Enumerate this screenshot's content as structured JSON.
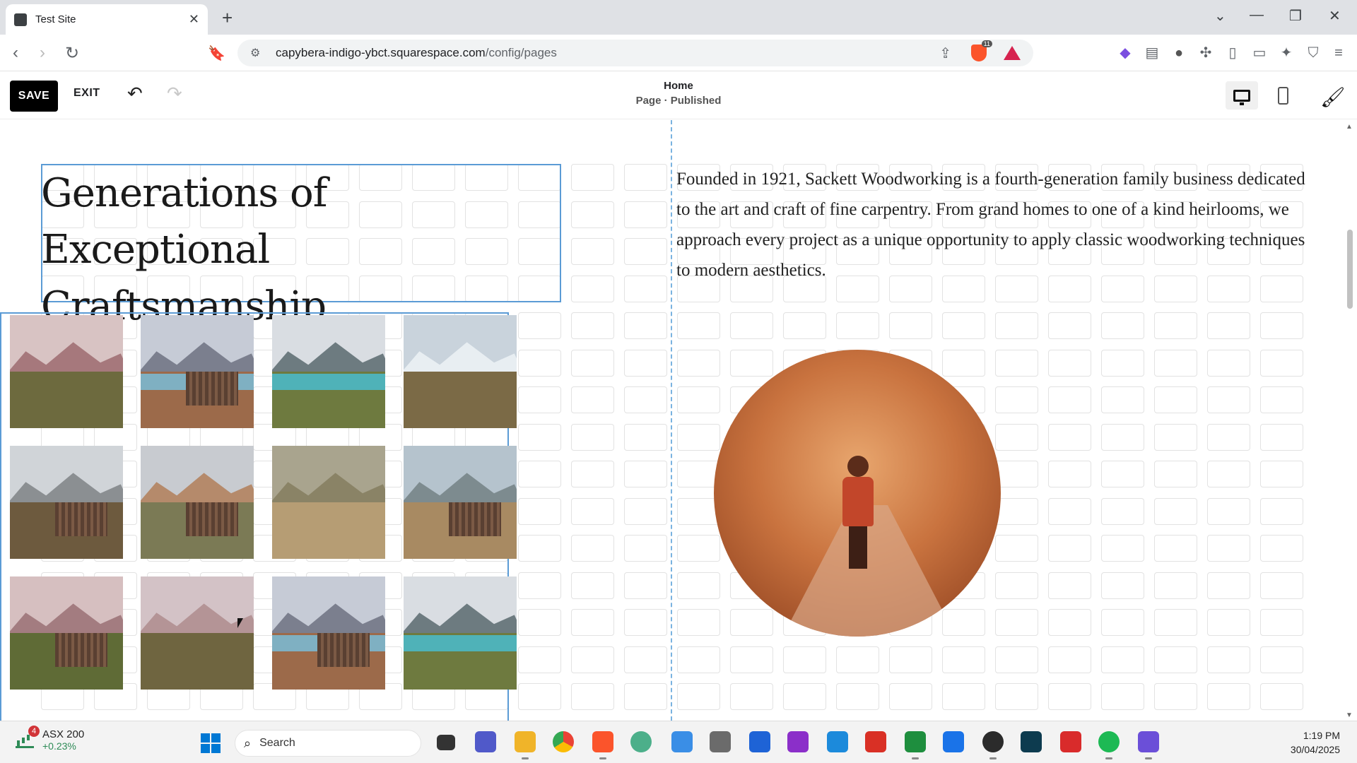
{
  "browser": {
    "tab_title": "Test Site",
    "url_domain": "capybera-indigo-ybct.squarespace.com",
    "url_path": "/config/pages",
    "shield_count": "11"
  },
  "editor": {
    "save_label": "SAVE",
    "exit_label": "EXIT",
    "page_name": "Home",
    "page_status": "Page · Published"
  },
  "content": {
    "headline": "Generations of Exceptional Craftsmanship",
    "paragraph": "Founded in 1921, Sackett Woodworking is a fourth-generation family business dedicated to the art and craft of fine carpentry. From grand homes to one of a kind heirlooms, we approach every project as a unique opportunity to apply classic woodworking techniques to modern aesthetics."
  },
  "gallery": {
    "images": [
      {
        "name": "gallery-image-1",
        "scene": "pink-mountains-grass"
      },
      {
        "name": "gallery-image-2",
        "scene": "cabin-lake"
      },
      {
        "name": "gallery-image-3",
        "scene": "turquoise-lake"
      },
      {
        "name": "gallery-image-4",
        "scene": "snowy-peaks"
      },
      {
        "name": "gallery-image-5",
        "scene": "cabin-doorway"
      },
      {
        "name": "gallery-image-6",
        "scene": "cabin-steps"
      },
      {
        "name": "gallery-image-7",
        "scene": "grass-hillside"
      },
      {
        "name": "gallery-image-8",
        "scene": "wooden-cabin"
      },
      {
        "name": "gallery-image-9",
        "scene": "pink-mountains-hut"
      },
      {
        "name": "gallery-image-10",
        "scene": "pink-mountains"
      },
      {
        "name": "gallery-image-11",
        "scene": "cabin-lake"
      },
      {
        "name": "gallery-image-12",
        "scene": "turquoise-lake"
      }
    ]
  },
  "taskbar": {
    "stock_name": "ASX 200",
    "stock_change": "+0.23%",
    "notification_count": "4",
    "search_label": "Search",
    "time": "1:19 PM",
    "date": "30/04/2025"
  },
  "colors": {
    "selection_blue": "#5b9bd5",
    "center_guide": "#7ab3e0",
    "save_bg": "#000000"
  }
}
